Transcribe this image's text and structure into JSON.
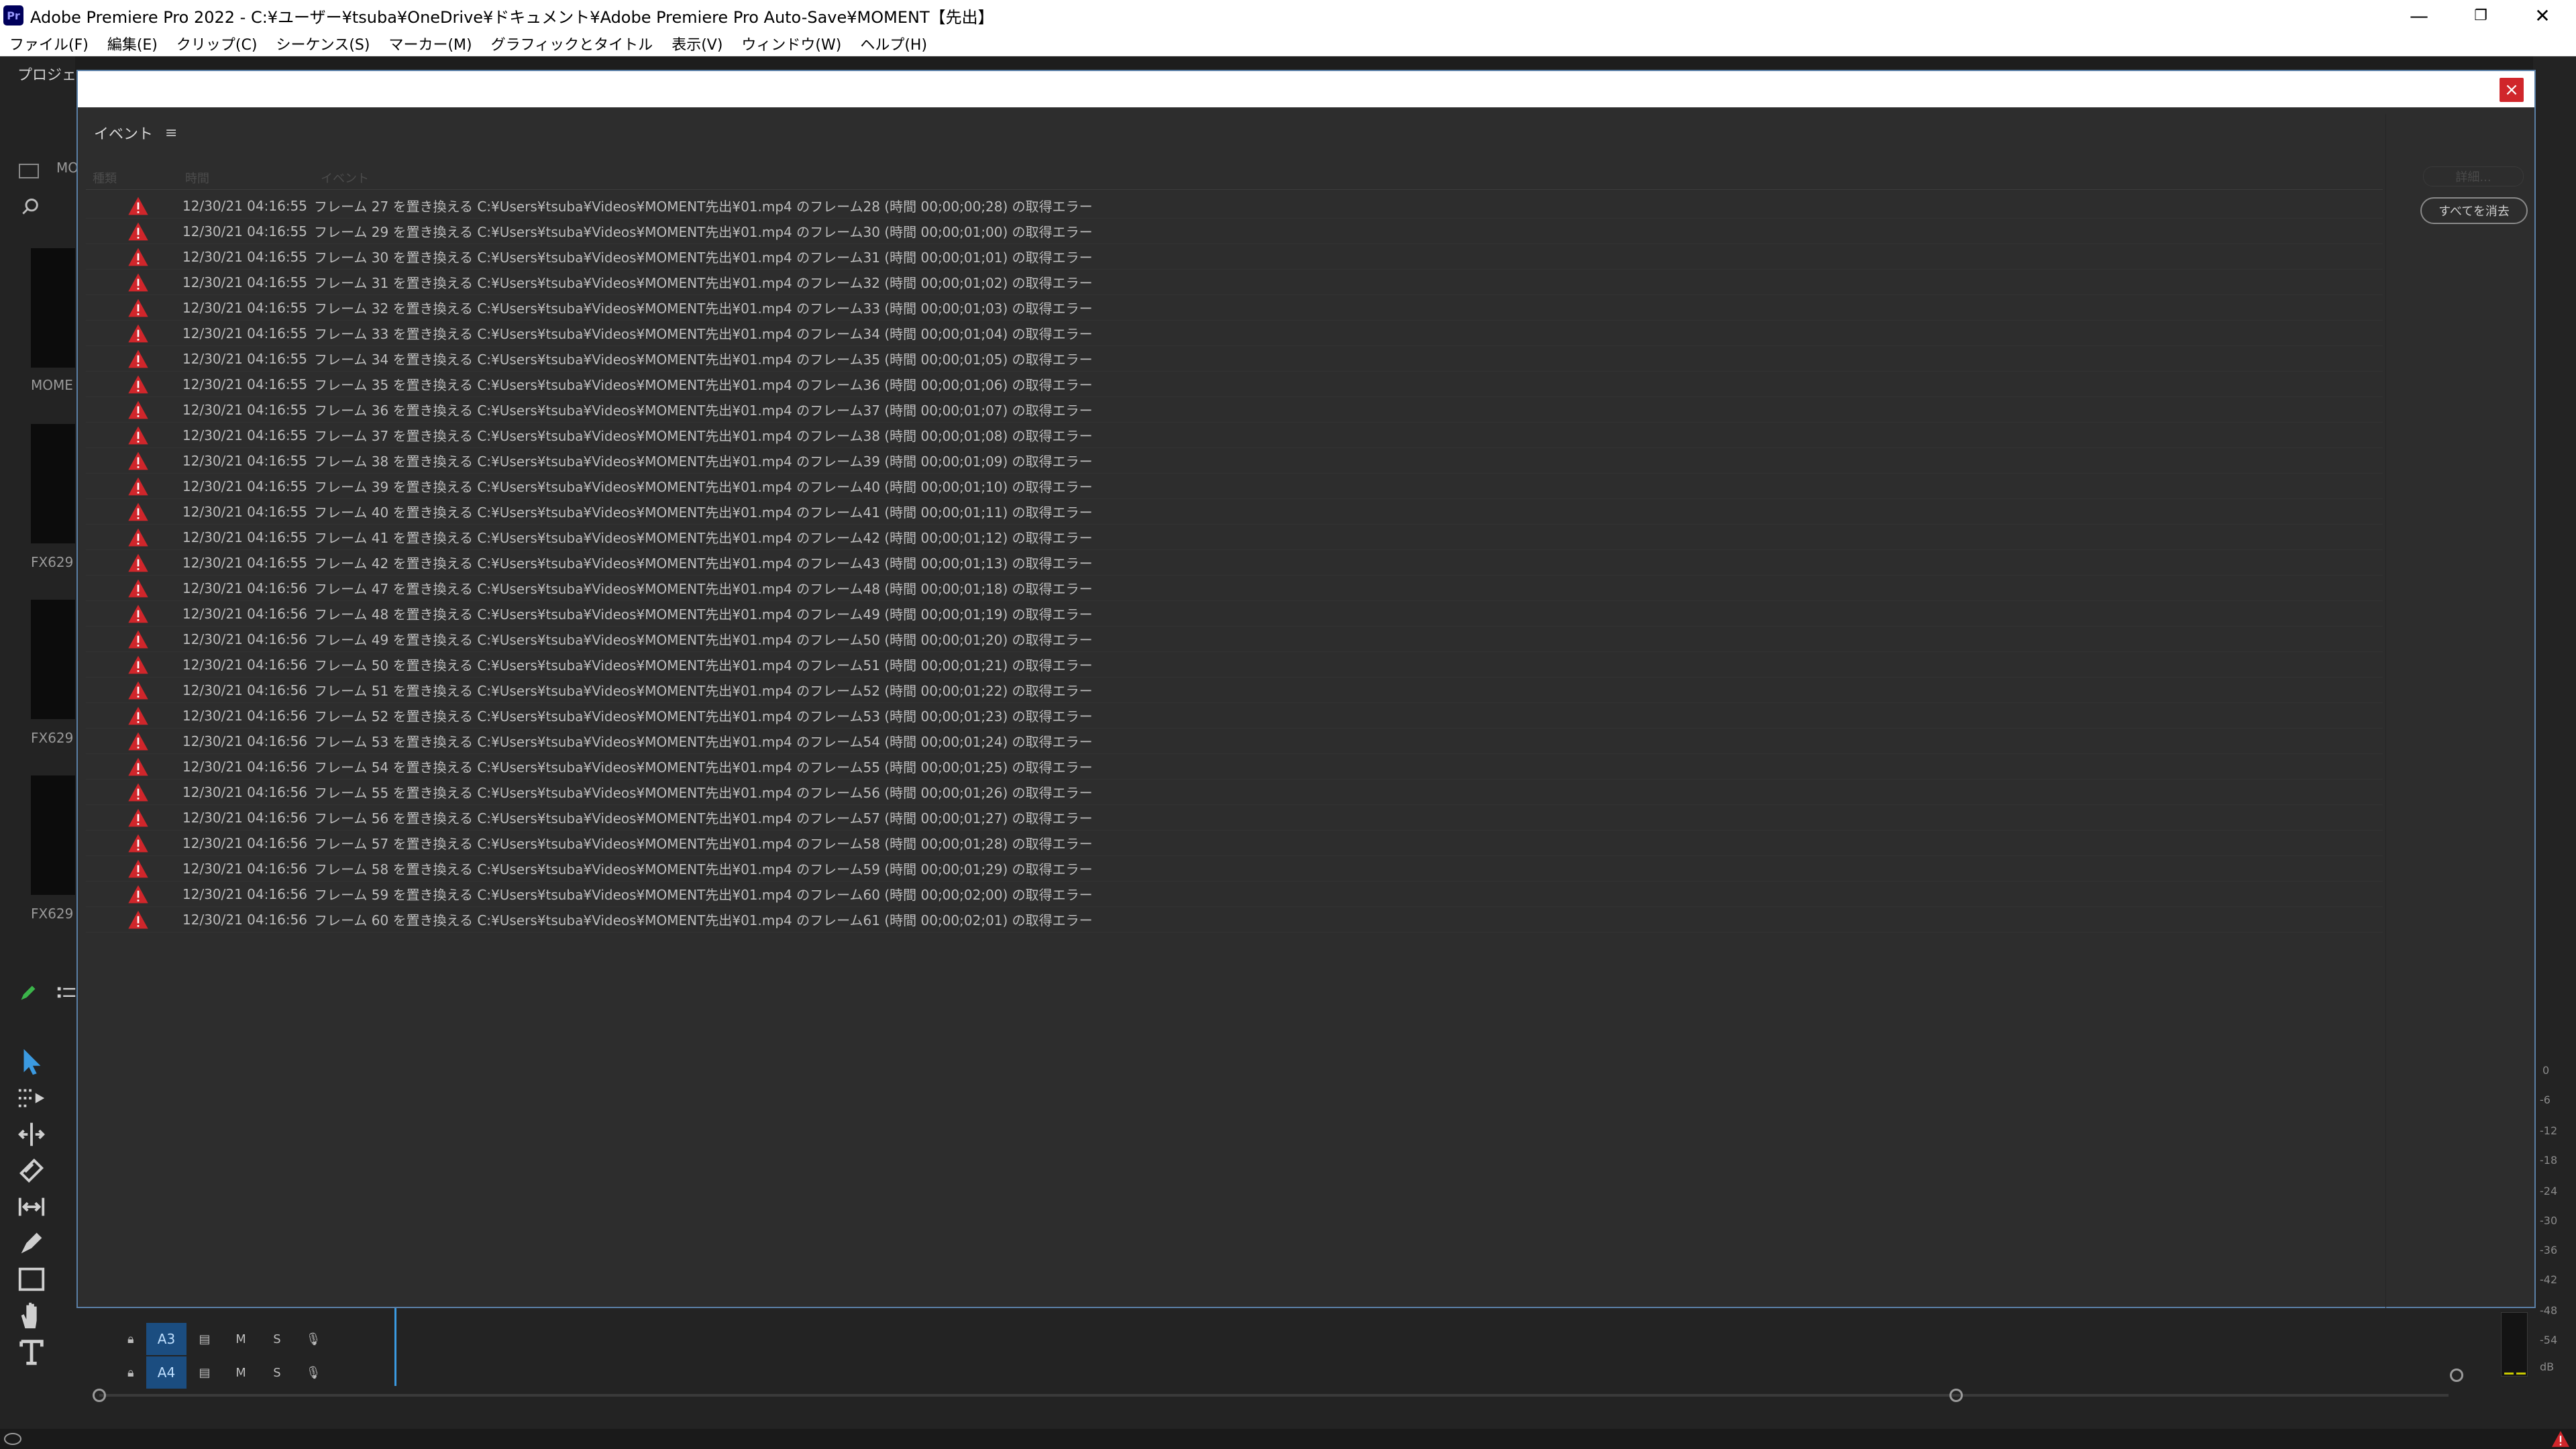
{
  "window": {
    "app_icon_text": "Pr",
    "title": "Adobe Premiere Pro 2022 - C:¥ユーザー¥tsuba¥OneDrive¥ドキュメント¥Adobe Premiere Pro Auto-Save¥MOMENT【先出】",
    "minimize": "—",
    "maximize": "❐",
    "close": "✕"
  },
  "menu": [
    "ファイル(F)",
    "編集(E)",
    "クリップ(C)",
    "シーケンス(S)",
    "マーカー(M)",
    "グラフィックとタイトル",
    "表示(V)",
    "ウィンドウ(W)",
    "ヘルプ(H)"
  ],
  "project_panel": {
    "tab_label": "プロジェ",
    "bin_label": "MO",
    "thumbnails": [
      "MOME",
      "FX629",
      "FX629",
      "FX629"
    ]
  },
  "timeline": {
    "tracks": [
      {
        "id": "A3",
        "m": "M",
        "s": "S"
      },
      {
        "id": "A4",
        "m": "M",
        "s": "S"
      }
    ]
  },
  "meter_ticks": [
    "0",
    "-6",
    "-12",
    "-18",
    "-24",
    "-30",
    "-36",
    "-42",
    "-48",
    "-54",
    "dB"
  ],
  "dialog": {
    "close_label": "×",
    "panel_title": "イベント",
    "menu_icon": "≡",
    "columns": {
      "type": "種類",
      "time": "時間",
      "event": "イベント"
    },
    "details_button": "詳細...",
    "clear_all_button": "すべてを消去",
    "events": [
      {
        "time": "12/30/21 04:16:55",
        "text": "フレーム 27 を置き換える C:¥Users¥tsuba¥Videos¥MOMENT先出¥01.mp4 のフレーム28 (時間 00;00;00;28) の取得エラー"
      },
      {
        "time": "12/30/21 04:16:55",
        "text": "フレーム 29 を置き換える C:¥Users¥tsuba¥Videos¥MOMENT先出¥01.mp4 のフレーム30 (時間 00;00;01;00) の取得エラー"
      },
      {
        "time": "12/30/21 04:16:55",
        "text": "フレーム 30 を置き換える C:¥Users¥tsuba¥Videos¥MOMENT先出¥01.mp4 のフレーム31 (時間 00;00;01;01) の取得エラー"
      },
      {
        "time": "12/30/21 04:16:55",
        "text": "フレーム 31 を置き換える C:¥Users¥tsuba¥Videos¥MOMENT先出¥01.mp4 のフレーム32 (時間 00;00;01;02) の取得エラー"
      },
      {
        "time": "12/30/21 04:16:55",
        "text": "フレーム 32 を置き換える C:¥Users¥tsuba¥Videos¥MOMENT先出¥01.mp4 のフレーム33 (時間 00;00;01;03) の取得エラー"
      },
      {
        "time": "12/30/21 04:16:55",
        "text": "フレーム 33 を置き換える C:¥Users¥tsuba¥Videos¥MOMENT先出¥01.mp4 のフレーム34 (時間 00;00;01;04) の取得エラー"
      },
      {
        "time": "12/30/21 04:16:55",
        "text": "フレーム 34 を置き換える C:¥Users¥tsuba¥Videos¥MOMENT先出¥01.mp4 のフレーム35 (時間 00;00;01;05) の取得エラー"
      },
      {
        "time": "12/30/21 04:16:55",
        "text": "フレーム 35 を置き換える C:¥Users¥tsuba¥Videos¥MOMENT先出¥01.mp4 のフレーム36 (時間 00;00;01;06) の取得エラー"
      },
      {
        "time": "12/30/21 04:16:55",
        "text": "フレーム 36 を置き換える C:¥Users¥tsuba¥Videos¥MOMENT先出¥01.mp4 のフレーム37 (時間 00;00;01;07) の取得エラー"
      },
      {
        "time": "12/30/21 04:16:55",
        "text": "フレーム 37 を置き換える C:¥Users¥tsuba¥Videos¥MOMENT先出¥01.mp4 のフレーム38 (時間 00;00;01;08) の取得エラー"
      },
      {
        "time": "12/30/21 04:16:55",
        "text": "フレーム 38 を置き換える C:¥Users¥tsuba¥Videos¥MOMENT先出¥01.mp4 のフレーム39 (時間 00;00;01;09) の取得エラー"
      },
      {
        "time": "12/30/21 04:16:55",
        "text": "フレーム 39 を置き換える C:¥Users¥tsuba¥Videos¥MOMENT先出¥01.mp4 のフレーム40 (時間 00;00;01;10) の取得エラー"
      },
      {
        "time": "12/30/21 04:16:55",
        "text": "フレーム 40 を置き換える C:¥Users¥tsuba¥Videos¥MOMENT先出¥01.mp4 のフレーム41 (時間 00;00;01;11) の取得エラー"
      },
      {
        "time": "12/30/21 04:16:55",
        "text": "フレーム 41 を置き換える C:¥Users¥tsuba¥Videos¥MOMENT先出¥01.mp4 のフレーム42 (時間 00;00;01;12) の取得エラー"
      },
      {
        "time": "12/30/21 04:16:55",
        "text": "フレーム 42 を置き換える C:¥Users¥tsuba¥Videos¥MOMENT先出¥01.mp4 のフレーム43 (時間 00;00;01;13) の取得エラー"
      },
      {
        "time": "12/30/21 04:16:56",
        "text": "フレーム 47 を置き換える C:¥Users¥tsuba¥Videos¥MOMENT先出¥01.mp4 のフレーム48 (時間 00;00;01;18) の取得エラー"
      },
      {
        "time": "12/30/21 04:16:56",
        "text": "フレーム 48 を置き換える C:¥Users¥tsuba¥Videos¥MOMENT先出¥01.mp4 のフレーム49 (時間 00;00;01;19) の取得エラー"
      },
      {
        "time": "12/30/21 04:16:56",
        "text": "フレーム 49 を置き換える C:¥Users¥tsuba¥Videos¥MOMENT先出¥01.mp4 のフレーム50 (時間 00;00;01;20) の取得エラー"
      },
      {
        "time": "12/30/21 04:16:56",
        "text": "フレーム 50 を置き換える C:¥Users¥tsuba¥Videos¥MOMENT先出¥01.mp4 のフレーム51 (時間 00;00;01;21) の取得エラー"
      },
      {
        "time": "12/30/21 04:16:56",
        "text": "フレーム 51 を置き換える C:¥Users¥tsuba¥Videos¥MOMENT先出¥01.mp4 のフレーム52 (時間 00;00;01;22) の取得エラー"
      },
      {
        "time": "12/30/21 04:16:56",
        "text": "フレーム 52 を置き換える C:¥Users¥tsuba¥Videos¥MOMENT先出¥01.mp4 のフレーム53 (時間 00;00;01;23) の取得エラー"
      },
      {
        "time": "12/30/21 04:16:56",
        "text": "フレーム 53 を置き換える C:¥Users¥tsuba¥Videos¥MOMENT先出¥01.mp4 のフレーム54 (時間 00;00;01;24) の取得エラー"
      },
      {
        "time": "12/30/21 04:16:56",
        "text": "フレーム 54 を置き換える C:¥Users¥tsuba¥Videos¥MOMENT先出¥01.mp4 のフレーム55 (時間 00;00;01;25) の取得エラー"
      },
      {
        "time": "12/30/21 04:16:56",
        "text": "フレーム 55 を置き換える C:¥Users¥tsuba¥Videos¥MOMENT先出¥01.mp4 のフレーム56 (時間 00;00;01;26) の取得エラー"
      },
      {
        "time": "12/30/21 04:16:56",
        "text": "フレーム 56 を置き換える C:¥Users¥tsuba¥Videos¥MOMENT先出¥01.mp4 のフレーム57 (時間 00;00;01;27) の取得エラー"
      },
      {
        "time": "12/30/21 04:16:56",
        "text": "フレーム 57 を置き換える C:¥Users¥tsuba¥Videos¥MOMENT先出¥01.mp4 のフレーム58 (時間 00;00;01;28) の取得エラー"
      },
      {
        "time": "12/30/21 04:16:56",
        "text": "フレーム 58 を置き換える C:¥Users¥tsuba¥Videos¥MOMENT先出¥01.mp4 のフレーム59 (時間 00;00;01;29) の取得エラー"
      },
      {
        "time": "12/30/21 04:16:56",
        "text": "フレーム 59 を置き換える C:¥Users¥tsuba¥Videos¥MOMENT先出¥01.mp4 のフレーム60 (時間 00;00;02;00) の取得エラー"
      },
      {
        "time": "12/30/21 04:16:56",
        "text": "フレーム 60 を置き換える C:¥Users¥tsuba¥Videos¥MOMENT先出¥01.mp4 のフレーム61 (時間 00;00;02;01) の取得エラー"
      }
    ]
  },
  "colors": {
    "warning": "#d0262b",
    "accent": "#3b9ae1",
    "track_highlight": "#1b4d80"
  }
}
